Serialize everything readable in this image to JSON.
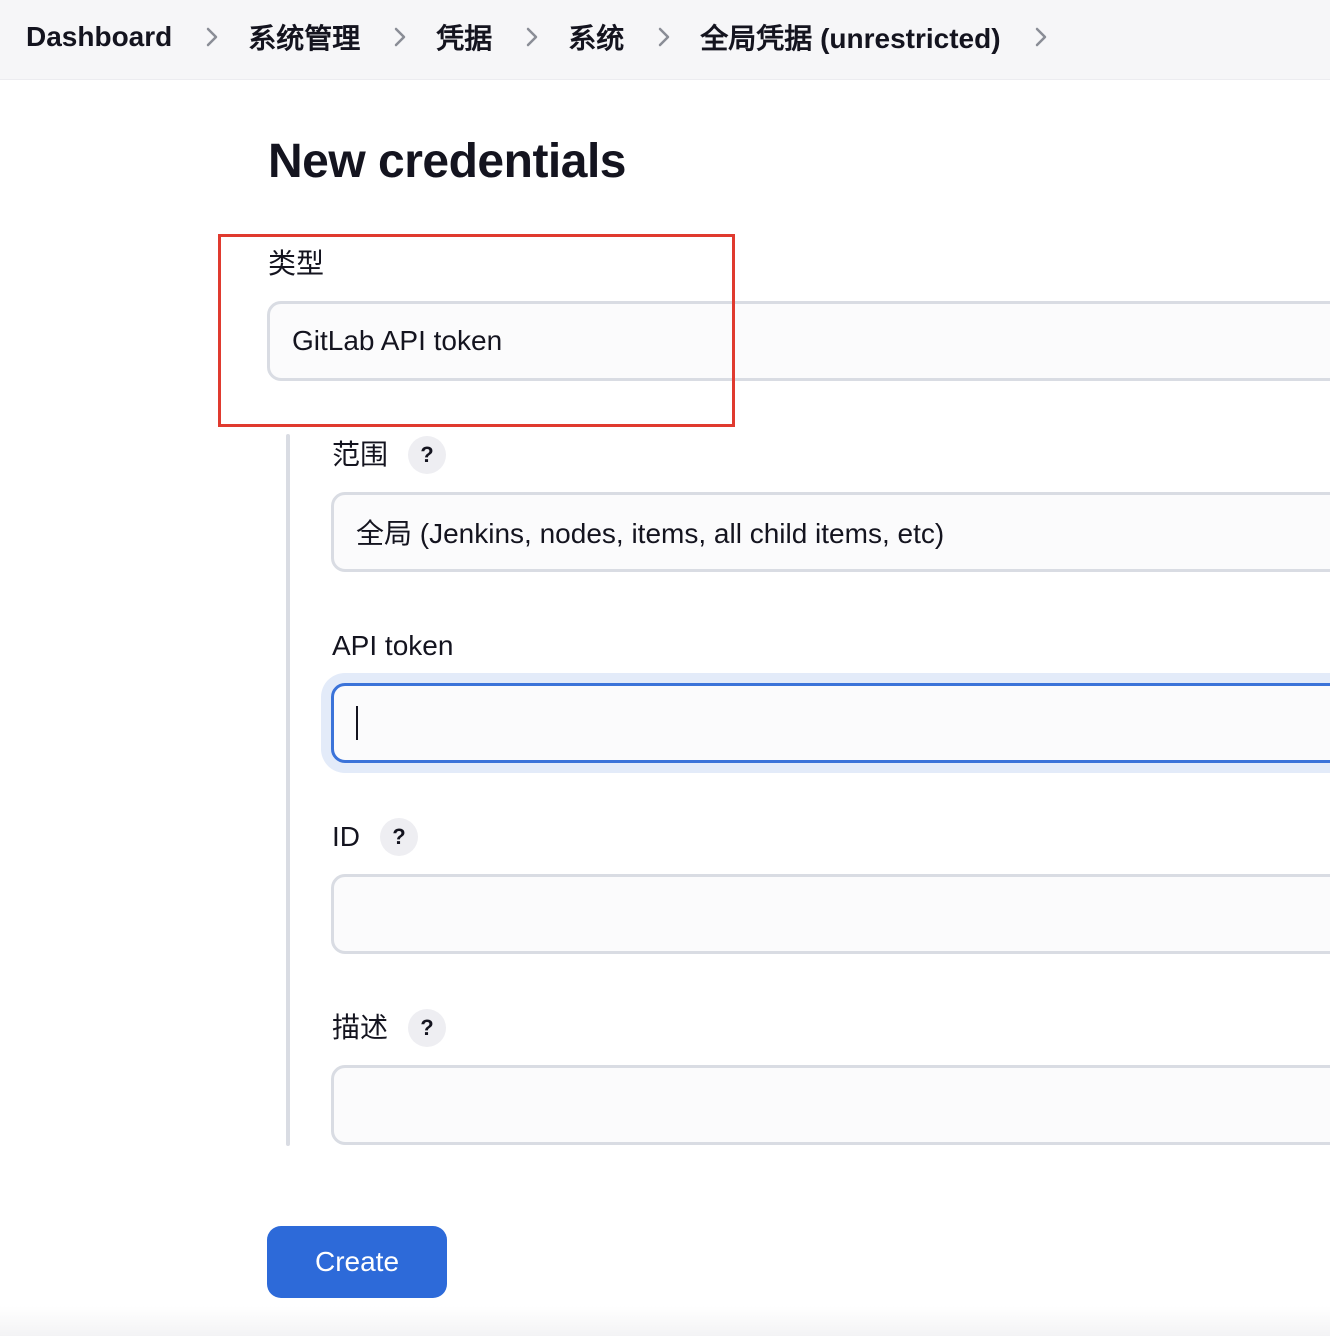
{
  "breadcrumb": {
    "items": [
      "Dashboard",
      "系统管理",
      "凭据",
      "系统",
      "全局凭据 (unrestricted)"
    ]
  },
  "page": {
    "title": "New credentials"
  },
  "form": {
    "kind": {
      "label": "类型",
      "value": "GitLab API token"
    },
    "scope": {
      "label": "范围",
      "help": "?",
      "value": "全局 (Jenkins, nodes, items, all child items, etc)"
    },
    "api_token": {
      "label": "API token",
      "value": ""
    },
    "id": {
      "label": "ID",
      "help": "?",
      "value": ""
    },
    "description": {
      "label": "描述",
      "help": "?",
      "value": ""
    },
    "submit_label": "Create"
  },
  "colors": {
    "accent": "#2d6ad9",
    "highlight": "#e03a2f"
  },
  "icons": {
    "breadcrumb_separator": "chevron-right-icon",
    "help": "help-icon"
  }
}
